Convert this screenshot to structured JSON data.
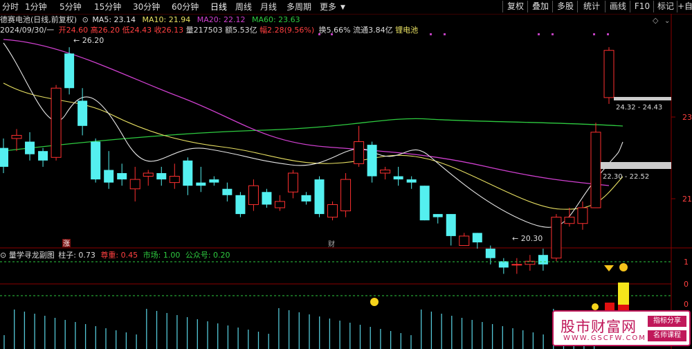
{
  "toolbar": {
    "periods": [
      "分时",
      "1分钟",
      "5分钟",
      "15分钟",
      "30分钟",
      "60分钟",
      "日线",
      "周线",
      "月线",
      "多周期",
      "更多"
    ],
    "active": "日线",
    "right_buttons": [
      "复权",
      "叠加",
      "多股",
      "统计",
      "画线",
      "F10",
      "标记",
      "+自选"
    ],
    "back_icon": "back-arrow-icon"
  },
  "stock": {
    "name": "德赛电池(日线,前复权)",
    "ma5_label": "MA5: 23.14",
    "ma10_label": "MA10: 21.94",
    "ma20_label": "MA20: 22.12",
    "ma60_label": "MA60: 23.63",
    "date": "2024/09/30/一",
    "open": "开24.60",
    "high": "高26.20",
    "low": "低24.43",
    "close": "收26.13",
    "volume": "量217503",
    "amount": "额5.53亿",
    "amplitude": "幅2.28(9.56%)",
    "turnover": "换5.66%",
    "float": "流通3.84亿",
    "concept": "锂电池"
  },
  "chart": {
    "price_axis": [
      "23",
      "21"
    ],
    "price_labels": {
      "high": "26.20",
      "low": "20.30"
    },
    "zones": [
      "24.32 - 24.43",
      "22.30 - 22.52"
    ],
    "markers": [
      "涨",
      "财"
    ]
  },
  "indicator": {
    "name": "量学寻龙副图",
    "zhuzi": "柱子: 0.73",
    "zunzhong": "尊重: 0.45",
    "shichang": "市场: 1.00",
    "gongzhonghao": "公众号: 0.20",
    "axis": [
      "1",
      "0",
      "0"
    ]
  },
  "chart_data": {
    "type": "candlestick",
    "price_ylim": [
      20.0,
      26.6
    ],
    "candles": [
      {
        "o": 23.0,
        "c": 22.4,
        "h": 23.3,
        "l": 22.2
      },
      {
        "o": 23.3,
        "c": 23.4,
        "h": 23.6,
        "l": 22.9
      },
      {
        "o": 23.2,
        "c": 22.8,
        "h": 23.5,
        "l": 22.6
      },
      {
        "o": 22.9,
        "c": 22.6,
        "h": 23.0,
        "l": 22.4
      },
      {
        "o": 22.7,
        "c": 24.9,
        "h": 25.0,
        "l": 22.6
      },
      {
        "o": 26.0,
        "c": 24.9,
        "h": 26.2,
        "l": 24.7
      },
      {
        "o": 24.5,
        "c": 23.7,
        "h": 24.9,
        "l": 23.4
      },
      {
        "o": 23.2,
        "c": 22.0,
        "h": 23.3,
        "l": 21.9
      },
      {
        "o": 22.3,
        "c": 21.9,
        "h": 22.9,
        "l": 21.7
      },
      {
        "o": 22.2,
        "c": 22.0,
        "h": 22.5,
        "l": 21.8
      },
      {
        "o": 21.7,
        "c": 22.0,
        "h": 22.4,
        "l": 21.3
      },
      {
        "o": 22.1,
        "c": 22.2,
        "h": 22.3,
        "l": 21.8
      },
      {
        "o": 22.2,
        "c": 22.0,
        "h": 22.4,
        "l": 21.8
      },
      {
        "o": 21.9,
        "c": 22.1,
        "h": 22.5,
        "l": 21.7
      },
      {
        "o": 22.6,
        "c": 21.8,
        "h": 22.7,
        "l": 21.5
      },
      {
        "o": 21.9,
        "c": 21.8,
        "h": 22.4,
        "l": 21.6
      },
      {
        "o": 22.0,
        "c": 21.9,
        "h": 22.1,
        "l": 21.8
      },
      {
        "o": 21.7,
        "c": 21.5,
        "h": 21.9,
        "l": 21.3
      },
      {
        "o": 21.5,
        "c": 20.9,
        "h": 21.6,
        "l": 20.8
      },
      {
        "o": 21.2,
        "c": 21.8,
        "h": 22.0,
        "l": 21.0
      },
      {
        "o": 21.6,
        "c": 21.2,
        "h": 21.7,
        "l": 21.1
      },
      {
        "o": 21.1,
        "c": 21.3,
        "h": 21.5,
        "l": 21.0
      },
      {
        "o": 21.6,
        "c": 22.2,
        "h": 22.3,
        "l": 21.4
      },
      {
        "o": 21.5,
        "c": 21.3,
        "h": 21.6,
        "l": 21.2
      },
      {
        "o": 22.0,
        "c": 20.9,
        "h": 22.1,
        "l": 20.8
      },
      {
        "o": 20.8,
        "c": 21.2,
        "h": 21.3,
        "l": 20.7
      },
      {
        "o": 21.0,
        "c": 22.0,
        "h": 22.2,
        "l": 20.8
      },
      {
        "o": 22.5,
        "c": 23.2,
        "h": 23.7,
        "l": 22.4
      },
      {
        "o": 23.1,
        "c": 22.1,
        "h": 23.2,
        "l": 21.9
      },
      {
        "o": 22.2,
        "c": 22.3,
        "h": 22.4,
        "l": 22.0
      },
      {
        "o": 22.1,
        "c": 22.0,
        "h": 22.4,
        "l": 21.8
      },
      {
        "o": 22.0,
        "c": 21.9,
        "h": 22.1,
        "l": 21.7
      },
      {
        "o": 21.8,
        "c": 20.7,
        "h": 21.8,
        "l": 20.7
      },
      {
        "o": 20.9,
        "c": 20.8,
        "h": 20.9,
        "l": 20.6
      },
      {
        "o": 20.9,
        "c": 20.2,
        "h": 20.9,
        "l": 19.9
      },
      {
        "o": 19.9,
        "c": 20.2,
        "h": 20.3,
        "l": 19.9
      },
      {
        "o": 20.3,
        "c": 20.0,
        "h": 20.3,
        "l": 19.8
      },
      {
        "o": 19.8,
        "c": 19.5,
        "h": 19.9,
        "l": 19.3
      },
      {
        "o": 19.4,
        "c": 19.2,
        "h": 19.5,
        "l": 19.0
      },
      {
        "o": 19.3,
        "c": 19.3,
        "h": 19.5,
        "l": 19.0
      },
      {
        "o": 19.3,
        "c": 19.4,
        "h": 19.6,
        "l": 19.1
      },
      {
        "o": 19.6,
        "c": 19.3,
        "h": 19.8,
        "l": 19.1
      },
      {
        "o": 19.5,
        "c": 20.8,
        "h": 20.9,
        "l": 19.4
      },
      {
        "o": 20.6,
        "c": 20.8,
        "h": 21.1,
        "l": 20.5
      },
      {
        "o": 20.6,
        "c": 21.1,
        "h": 21.3,
        "l": 20.4
      },
      {
        "o": 21.1,
        "c": 23.5,
        "h": 23.8,
        "l": 21.1
      },
      {
        "o": 24.6,
        "c": 26.1,
        "h": 26.2,
        "l": 24.4
      }
    ],
    "volume_bars": "multiple"
  }
}
